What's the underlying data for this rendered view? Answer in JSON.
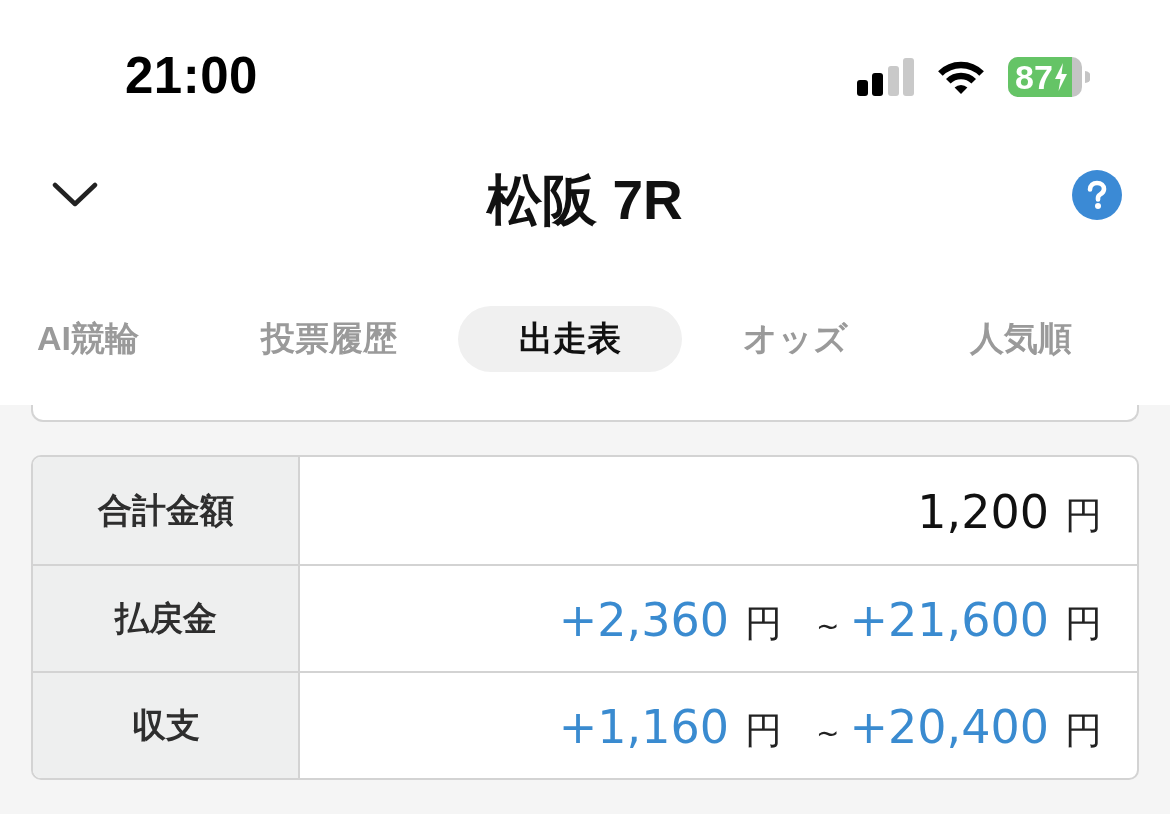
{
  "status_bar": {
    "time": "21:00",
    "battery_percent": "87"
  },
  "header": {
    "title": "松阪 7R"
  },
  "tabs": [
    {
      "label": "AI競輪",
      "selected": false
    },
    {
      "label": "投票履歴",
      "selected": false
    },
    {
      "label": "出走表",
      "selected": true
    },
    {
      "label": "オッズ",
      "selected": false
    },
    {
      "label": "人気順",
      "selected": false
    }
  ],
  "summary": {
    "rows": [
      {
        "label": "合計金額",
        "kind": "total",
        "values": [
          {
            "amount": "1,200",
            "unit": "円"
          }
        ]
      },
      {
        "label": "払戻金",
        "kind": "range",
        "values": [
          {
            "amount": "+2,360",
            "unit": "円"
          },
          {
            "amount": "+21,600",
            "unit": "円"
          }
        ],
        "separator": "~"
      },
      {
        "label": "収支",
        "kind": "range",
        "values": [
          {
            "amount": "+1,160",
            "unit": "円"
          },
          {
            "amount": "+20,400",
            "unit": "円"
          }
        ],
        "separator": "~"
      }
    ]
  }
}
